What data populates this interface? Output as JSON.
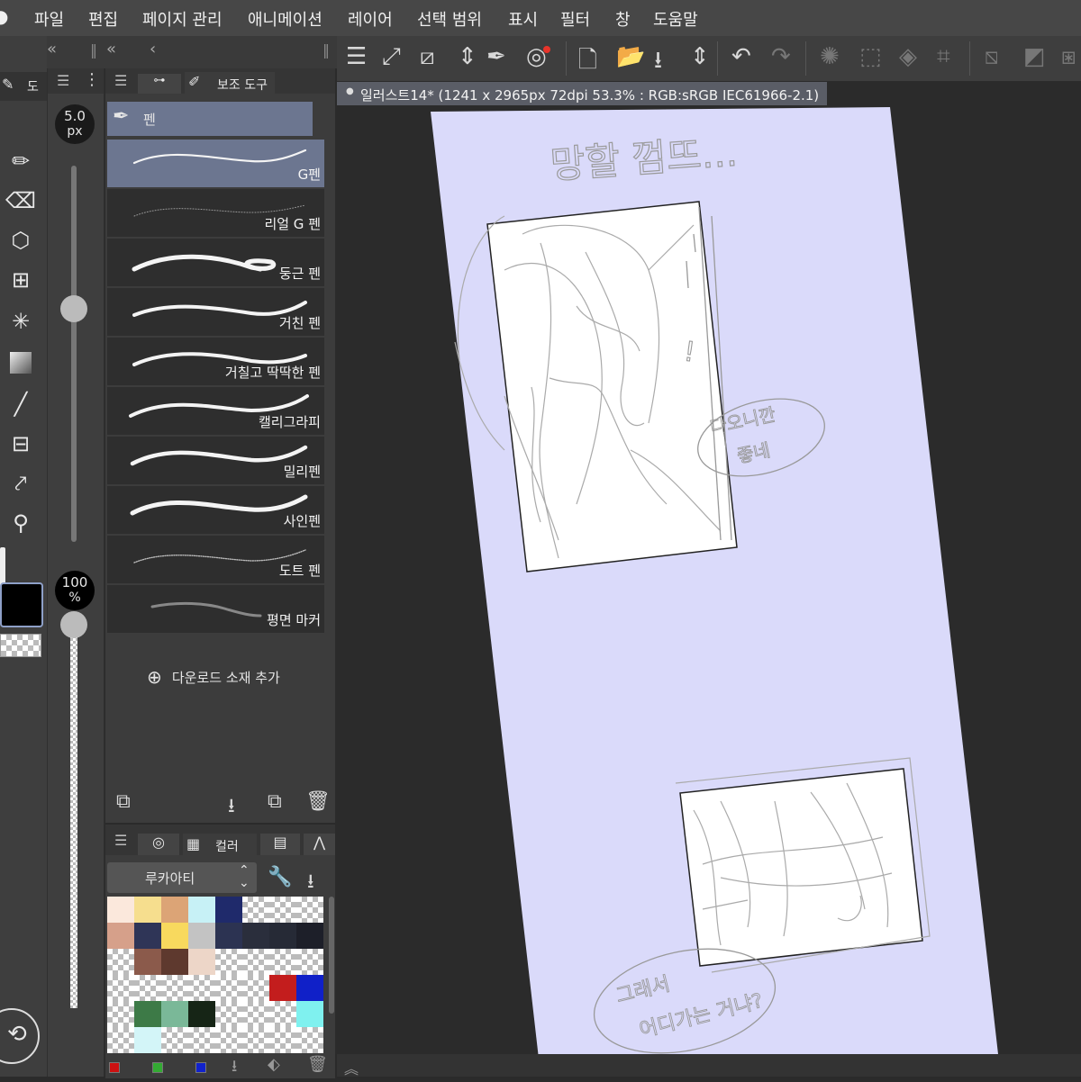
{
  "menu": [
    "파일",
    "편집",
    "페이지 관리",
    "애니메이션",
    "레이어",
    "선택 범위",
    "표시",
    "필터",
    "창",
    "도움말"
  ],
  "panels": {
    "tool_tab_label": "도",
    "sub_tool_tab_label": "보조 도구",
    "color_tab_label": "컬러"
  },
  "brush_size": {
    "value": "5.0",
    "unit": "px",
    "slider_level": 0.62
  },
  "opacity": {
    "value": "100",
    "unit": "%",
    "slider_level": 1.0
  },
  "sub_tool": {
    "group_label": "펜",
    "brushes": [
      {
        "label": "G펜",
        "selected": true
      },
      {
        "label": "리얼 G 펜",
        "selected": false
      },
      {
        "label": "둥근 펜",
        "selected": false
      },
      {
        "label": "거친 펜",
        "selected": false
      },
      {
        "label": "거칠고 딱딱한 펜",
        "selected": false
      },
      {
        "label": "캘리그라피",
        "selected": false
      },
      {
        "label": "밀리펜",
        "selected": false
      },
      {
        "label": "사인펜",
        "selected": false
      },
      {
        "label": "도트 펜",
        "selected": false
      },
      {
        "label": "평면 마커",
        "selected": false
      }
    ],
    "add_material_label": "다운로드 소재 추가"
  },
  "color_set": {
    "name": "루카아티",
    "swatches": [
      [
        "#fbe8dc",
        "#f6de8e",
        "#dca476",
        "#c7f1f6",
        "#1f2a6b",
        "checker",
        "checker",
        "checker"
      ],
      [
        "#d6a08a",
        "#2f3557",
        "#f8d95e",
        "#c3c3c3",
        "#2c3352",
        "#2a2e3c",
        "#262a36",
        "#1d1f29"
      ],
      [
        "checker",
        "#8b5a4b",
        "#5e392e",
        "#edd6c8",
        "checker",
        "checker",
        "checker",
        "checker"
      ],
      [
        "checker",
        "checker",
        "checker",
        "checker",
        "checker",
        "checker",
        "#c31d1d",
        "#1020c8"
      ],
      [
        "checker",
        "#3d7a47",
        "#7ab898",
        "#162516",
        "checker",
        "checker",
        "checker",
        "#7ff1ef"
      ],
      [
        "checker",
        "#d3f5f8",
        "checker",
        "checker",
        "checker",
        "checker",
        "checker",
        "checker"
      ]
    ]
  },
  "document": {
    "tab_title": "일러스트14* (1241 x 2965px 72dpi 53.3% : RGB:sRGB IEC61966-2.1)",
    "canvas_color": "#dadafa"
  },
  "sketch_text": {
    "title": "망할 껌뜨...",
    "bubble1": [
      "다오니깐",
      "좋네"
    ],
    "bubble2": [
      "그래서",
      "어디가는 거냐?"
    ],
    "side": "!"
  },
  "colors": {
    "menu_bg": "#474747",
    "panel_bg": "#3c3c3c",
    "selected_brush": "#6c7690",
    "accent_red": "#e8342a"
  }
}
